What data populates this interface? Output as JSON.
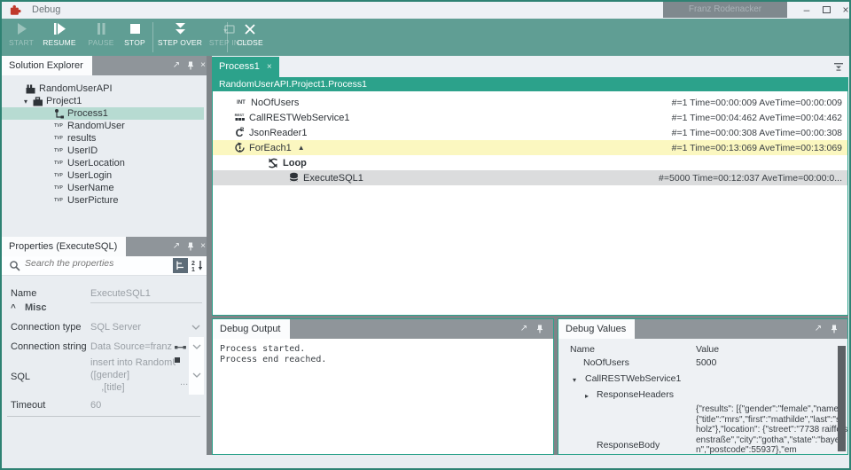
{
  "colors": {
    "accent_teal": "#2ca28b",
    "toolbar_green": "#609e94",
    "window_border": "#2e8273",
    "panel_header_gray": "#8f959a",
    "selected_row_teal": "#b7dbd2",
    "highlight_yellow": "#fbf7c0",
    "highlight_gray": "#dbdcdd",
    "titlebar_bg": "#eef1f5",
    "puzzle_red": "#c0392b"
  },
  "icons": {
    "popout": "↗",
    "close_x": "×",
    "minimize": "–",
    "int_badge": "INT",
    "tvp_badge": "TVP",
    "rest_badge": "REST",
    "json_letter": "C",
    "json_sup": "R",
    "sort_top": "2",
    "sort_bottom": "1"
  },
  "window": {
    "title": "Debug",
    "user_badge": "Franz Rodenacker"
  },
  "toolbar": {
    "buttons": [
      {
        "label": "START",
        "enabled": false
      },
      {
        "label": "RESUME",
        "enabled": true
      },
      {
        "label": "PAUSE",
        "enabled": false
      },
      {
        "label": "STOP",
        "enabled": true
      },
      {
        "label": "STEP OVER",
        "enabled": true
      },
      {
        "label": "STEP INTO",
        "enabled": false
      },
      {
        "label": "CLOSE",
        "enabled": true
      }
    ]
  },
  "solution_explorer": {
    "title": "Solution Explorer",
    "tree": [
      {
        "label": "RandomUserAPI",
        "expander": ""
      },
      {
        "label": "Project1",
        "expander": "▾"
      },
      {
        "label": "Process1",
        "expander": ""
      },
      {
        "label": "RandomUser",
        "expander": ""
      },
      {
        "label": "results",
        "expander": ""
      },
      {
        "label": "UserID",
        "expander": ""
      },
      {
        "label": "UserLocation",
        "expander": ""
      },
      {
        "label": "UserLogin",
        "expander": ""
      },
      {
        "label": "UserName",
        "expander": ""
      },
      {
        "label": "UserPicture",
        "expander": ""
      }
    ]
  },
  "properties": {
    "title": "Properties (ExecuteSQL)",
    "search_placeholder": "Search the properties",
    "name": {
      "label": "Name",
      "value": "ExecuteSQL1"
    },
    "section": "Misc",
    "connection_type": {
      "label": "Connection type",
      "value": "SQL Server"
    },
    "connection_string": {
      "label": "Connection string",
      "value": "Data Source=franzpc\\sqls"
    },
    "sql": {
      "label": "SQL",
      "line1": "insert into RandomUser",
      "line2": "([gender]",
      "line3": "    ,[title]",
      "more": "..."
    },
    "timeout": {
      "label": "Timeout",
      "value": "60"
    }
  },
  "editor": {
    "tab": "Process1",
    "breadcrumb": "RandomUserAPI.Project1.Process1",
    "steps": [
      {
        "label": "NoOfUsers",
        "stats": "#=1 Time=00:00:009 AveTime=00:00:009",
        "marker": ""
      },
      {
        "label": "CallRESTWebService1",
        "stats": "#=1 Time=00:04:462 AveTime=00:04:462",
        "marker": ""
      },
      {
        "label": "JsonReader1",
        "stats": "#=1 Time=00:00:308 AveTime=00:00:308",
        "marker": ""
      },
      {
        "label": "ForEach1",
        "stats": "#=1 Time=00:13:069 AveTime=00:13:069",
        "marker": "▲"
      },
      {
        "label": "Loop",
        "stats": "",
        "marker": ""
      },
      {
        "label": "ExecuteSQL1",
        "stats": "#=5000 Time=00:12:037 AveTime=00:00:0...",
        "marker": ""
      }
    ]
  },
  "debug_output": {
    "title": "Debug Output",
    "text": "Process started.\nProcess end reached."
  },
  "debug_values": {
    "title": "Debug Values",
    "columns": [
      "Name",
      "Value"
    ],
    "rows": [
      {
        "name": "NoOfUsers",
        "value": "5000",
        "expander": ""
      },
      {
        "name": "CallRESTWebService1",
        "value": "",
        "expander": "▾"
      },
      {
        "name": "ResponseHeaders",
        "value": "",
        "expander": "▸"
      },
      {
        "name": "ResponseBody",
        "value": "{\"results\": [{\"gender\":\"female\",\"name\": {\"title\":\"mrs\",\"first\":\"mathilde\",\"last\":\"scholz\"},\"location\": {\"street\":\"7738 raiffeisenstraße\",\"city\":\"gotha\",\"state\":\"bayern\",\"postcode\":55937},\"em",
        "expander": ""
      }
    ]
  }
}
